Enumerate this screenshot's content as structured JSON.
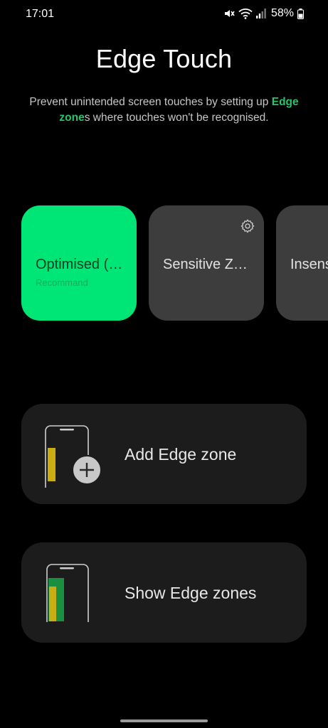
{
  "status_bar": {
    "time": "17:01",
    "battery": "58%"
  },
  "header": {
    "title": "Edge Touch",
    "desc_before": "Prevent unintended screen touches by setting up ",
    "desc_highlight": "Edge zone",
    "desc_after": "s where touches won't be recognised."
  },
  "modes": [
    {
      "label": "Optimised (…",
      "sub": "Recommand",
      "selected": true
    },
    {
      "label": "Sensitive Z…",
      "has_settings": true
    },
    {
      "label": "Insens"
    }
  ],
  "actions": {
    "add_label": "Add Edge zone",
    "show_label": "Show Edge zones"
  },
  "colors": {
    "accent": "#00e676",
    "highlight_text": "#27c46b",
    "card": "#3d3d3d",
    "panel": "#1c1c1c",
    "zone_yellow": "#c9ad12",
    "zone_green": "#1a8f3f"
  },
  "icons": [
    "mute-icon",
    "wifi-icon",
    "signal-icon",
    "battery-icon",
    "gear-icon",
    "add-icon"
  ]
}
